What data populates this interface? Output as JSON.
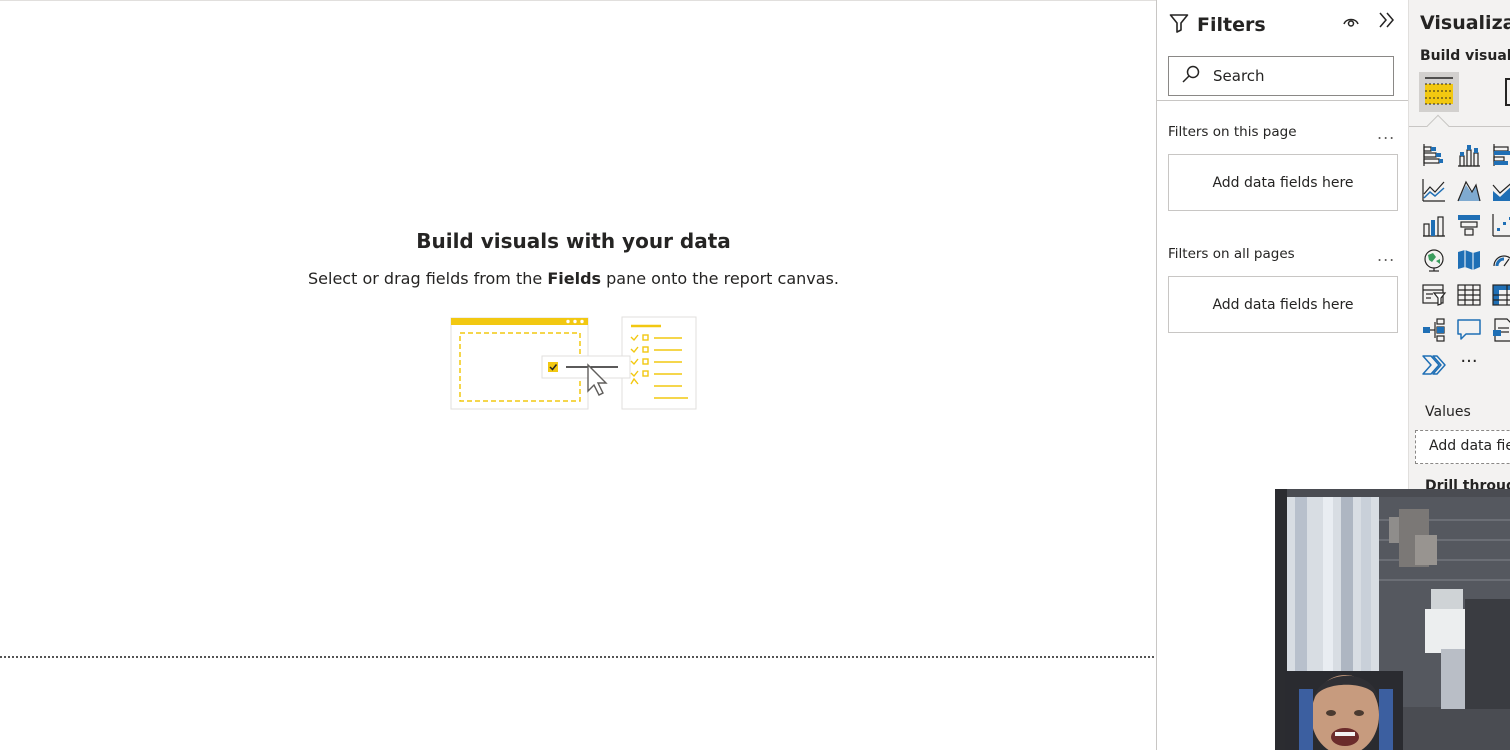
{
  "canvas": {
    "empty_title": "Build visuals with your data",
    "empty_sub_pre": "Select or drag fields from the ",
    "empty_sub_bold": "Fields",
    "empty_sub_post": " pane onto the report canvas."
  },
  "filters": {
    "title": "Filters",
    "search_placeholder": "Search",
    "this_page_label": "Filters on this page",
    "all_pages_label": "Filters on all pages",
    "more_label": "...",
    "add_fields": "Add data fields here"
  },
  "visualizations": {
    "title": "Visualizations",
    "build_visual": "Build visual",
    "values_label": "Values",
    "values_placeholder": "Add data fields here",
    "drill_label": "Drill through",
    "more_label": "···"
  },
  "colors": {
    "accent": "#f2c811",
    "icon_blue": "#1f6fb5",
    "text": "#252423"
  }
}
